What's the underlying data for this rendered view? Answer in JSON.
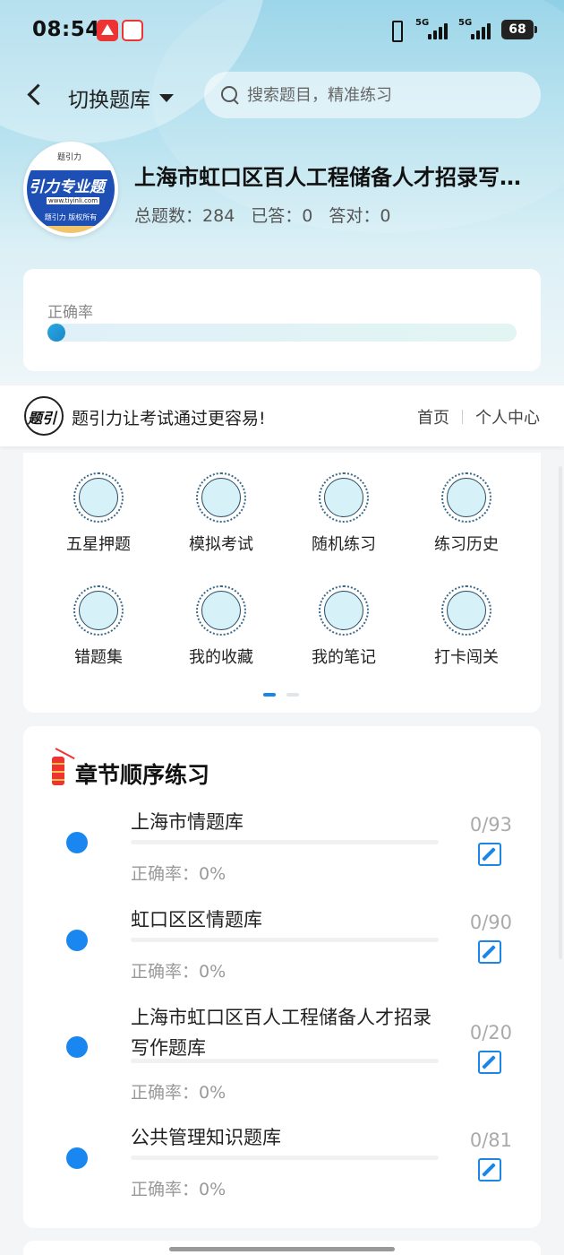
{
  "status_bar": {
    "time": "08:54",
    "network_1": "5G",
    "network_2": "5G",
    "battery": "68"
  },
  "header": {
    "switch_label": "切换题库",
    "search_placeholder": "搜索题目，精准练习"
  },
  "bank": {
    "logo_top": "题引力",
    "logo_text": "引力专业题",
    "logo_url": "www.tiyinli.com",
    "logo_copy": "题引力 版权所有",
    "title": "上海市虹口区百人工程储备人才招录写作题库",
    "stats": {
      "total_label": "总题数：",
      "total": "284",
      "answered_label": "已答：",
      "answered": "0",
      "correct_label": "答对：",
      "correct": "0"
    }
  },
  "accuracy": {
    "label": "正确率",
    "value": 0
  },
  "brand": {
    "logo_text": "题引力",
    "slogan": "题引力让考试通过更容易!",
    "nav": [
      "首页",
      "个人中心"
    ]
  },
  "menu": [
    {
      "label": "五星押题",
      "icon": "id-card-icon"
    },
    {
      "label": "模拟考试",
      "icon": "speedometer-icon"
    },
    {
      "label": "随机练习",
      "icon": "network-icon"
    },
    {
      "label": "练习历史",
      "icon": "history-icon"
    },
    {
      "label": "错题集",
      "icon": "head-icon"
    },
    {
      "label": "我的收藏",
      "icon": "heart-icon"
    },
    {
      "label": "我的笔记",
      "icon": "note-icon"
    },
    {
      "label": "打卡闯关",
      "icon": "sprout-icon"
    }
  ],
  "chapters": {
    "title": "章节顺序练习",
    "items": [
      {
        "name": "上海市情题库",
        "accuracy": "正确率：0%",
        "count": "0/93"
      },
      {
        "name": "虹口区区情题库",
        "accuracy": "正确率：0%",
        "count": "0/90"
      },
      {
        "name": "上海市虹口区百人工程储备人才招录写作题库",
        "accuracy": "正确率：0%",
        "count": "0/20"
      },
      {
        "name": "公共管理知识题库",
        "accuracy": "正确率：0%",
        "count": "0/81"
      }
    ]
  },
  "colors": {
    "accent": "#1a86e8",
    "dot": "#1a86f0",
    "hero_top": "#8fd0e6"
  }
}
